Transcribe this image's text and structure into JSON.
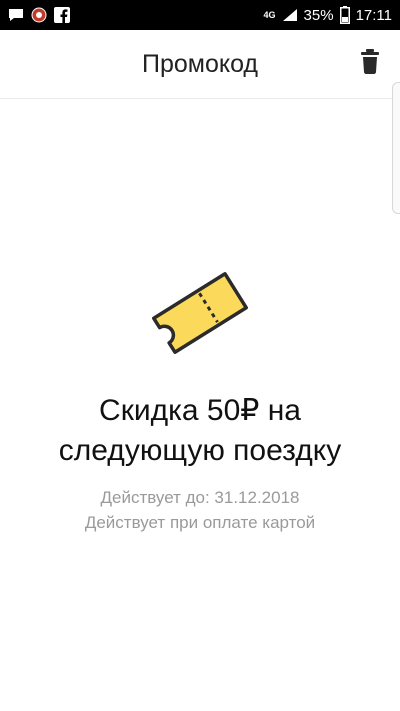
{
  "status_bar": {
    "network": "4G",
    "battery": "35%",
    "time": "17:11"
  },
  "header": {
    "title": "Промокод"
  },
  "promo": {
    "title_line1": "Скидка 50₽ на",
    "title_line2": "следующую поездку",
    "valid_until": "Действует до: 31.12.2018",
    "payment_note": "Действует при оплате картой"
  },
  "colors": {
    "ticket_fill": "#FBD95A",
    "ticket_stroke": "#2b2b2b",
    "status_bar_bg": "#000000",
    "secondary_text": "#9a9a9a"
  },
  "icons": {
    "delete": "trash-icon",
    "promo": "ticket-icon"
  }
}
